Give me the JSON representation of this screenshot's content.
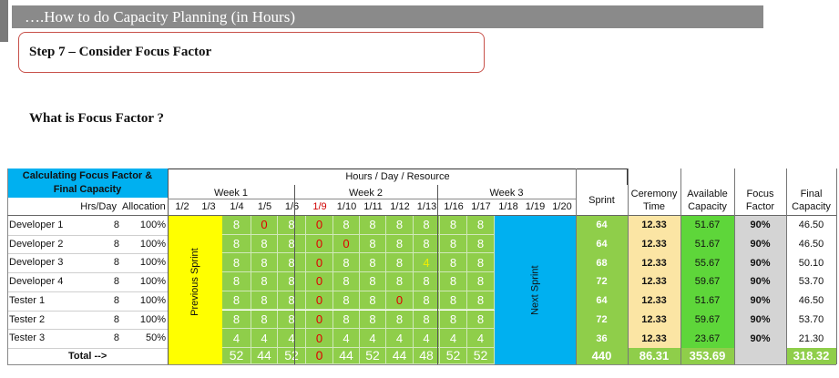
{
  "banner": {
    "title": "….How to do Capacity Planning (in Hours)"
  },
  "step": {
    "title": "Step 7 –  Consider Focus Factor"
  },
  "question": "What is Focus Factor ?",
  "table": {
    "corner_title": "Calculating Focus Factor & Final Capacity",
    "hours_header": "Hours / Day / Resource",
    "week_labels": [
      "Week 1",
      "Week 2",
      "Week 3"
    ],
    "col_hrs": "Hrs/Day",
    "col_alloc": "Allocation",
    "dates": [
      "1/2",
      "1/3",
      "1/4",
      "1/5",
      "1/6",
      "1/9",
      "1/10",
      "1/11",
      "1/12",
      "1/13",
      "1/16",
      "1/17",
      "1/18",
      "1/19",
      "1/20"
    ],
    "previous_sprint": "Previous Sprint",
    "next_sprint": "Next Sprint",
    "col_sprint": "Sprint",
    "col_ceremony": "Ceremony Time",
    "col_available": "Available Capacity",
    "col_focus": "Focus Factor",
    "col_final": "Final Capacity",
    "rows": [
      {
        "name": "Developer 1",
        "hrs": "8",
        "alloc": "100%",
        "days": [
          "8",
          "0",
          "8",
          "0",
          "8",
          "8",
          "8",
          "8",
          "8",
          "8"
        ],
        "sprint": "64",
        "ceremony": "12.33",
        "available": "51.67",
        "focus": "90%",
        "final": "46.50"
      },
      {
        "name": "Developer 2",
        "hrs": "8",
        "alloc": "100%",
        "days": [
          "8",
          "8",
          "8",
          "0",
          "0",
          "8",
          "8",
          "8",
          "8",
          "8"
        ],
        "sprint": "64",
        "ceremony": "12.33",
        "available": "51.67",
        "focus": "90%",
        "final": "46.50"
      },
      {
        "name": "Developer 3",
        "hrs": "8",
        "alloc": "100%",
        "days": [
          "8",
          "8",
          "8",
          "0",
          "8",
          "8",
          "8",
          "4",
          "8",
          "8"
        ],
        "sprint": "68",
        "ceremony": "12.33",
        "available": "55.67",
        "focus": "90%",
        "final": "50.10"
      },
      {
        "name": "Developer 4",
        "hrs": "8",
        "alloc": "100%",
        "days": [
          "8",
          "8",
          "8",
          "0",
          "8",
          "8",
          "8",
          "8",
          "8",
          "8"
        ],
        "sprint": "72",
        "ceremony": "12.33",
        "available": "59.67",
        "focus": "90%",
        "final": "53.70"
      },
      {
        "name": "Tester 1",
        "hrs": "8",
        "alloc": "100%",
        "days": [
          "8",
          "8",
          "8",
          "0",
          "8",
          "8",
          "0",
          "8",
          "8",
          "8"
        ],
        "sprint": "64",
        "ceremony": "12.33",
        "available": "51.67",
        "focus": "90%",
        "final": "46.50"
      },
      {
        "name": "Tester 2",
        "hrs": "8",
        "alloc": "100%",
        "days": [
          "8",
          "8",
          "8",
          "0",
          "8",
          "8",
          "8",
          "8",
          "8",
          "8"
        ],
        "sprint": "72",
        "ceremony": "12.33",
        "available": "59.67",
        "focus": "90%",
        "final": "53.70"
      },
      {
        "name": "Tester 3",
        "hrs": "8",
        "alloc": "50%",
        "days": [
          "4",
          "4",
          "4",
          "0",
          "4",
          "4",
          "4",
          "4",
          "4",
          "4"
        ],
        "sprint": "36",
        "ceremony": "12.33",
        "available": "23.67",
        "focus": "90%",
        "final": "21.30"
      }
    ],
    "total_label": "Total -->",
    "totals": {
      "days": [
        "52",
        "44",
        "52",
        "0",
        "44",
        "52",
        "44",
        "48",
        "52",
        "52"
      ],
      "sprint": "440",
      "ceremony": "86.31",
      "available": "353.69",
      "final": "318.32"
    },
    "colors": {
      "cell_green": "#8fce4a",
      "yellow": "#ffff00",
      "blue": "#00b0f0",
      "light_blue_header": "#00b0f0",
      "orange_red": "#e00000",
      "tan": "#fbe5a4",
      "bright_green": "#5ed63a",
      "gray": "#d4d4d4"
    }
  }
}
